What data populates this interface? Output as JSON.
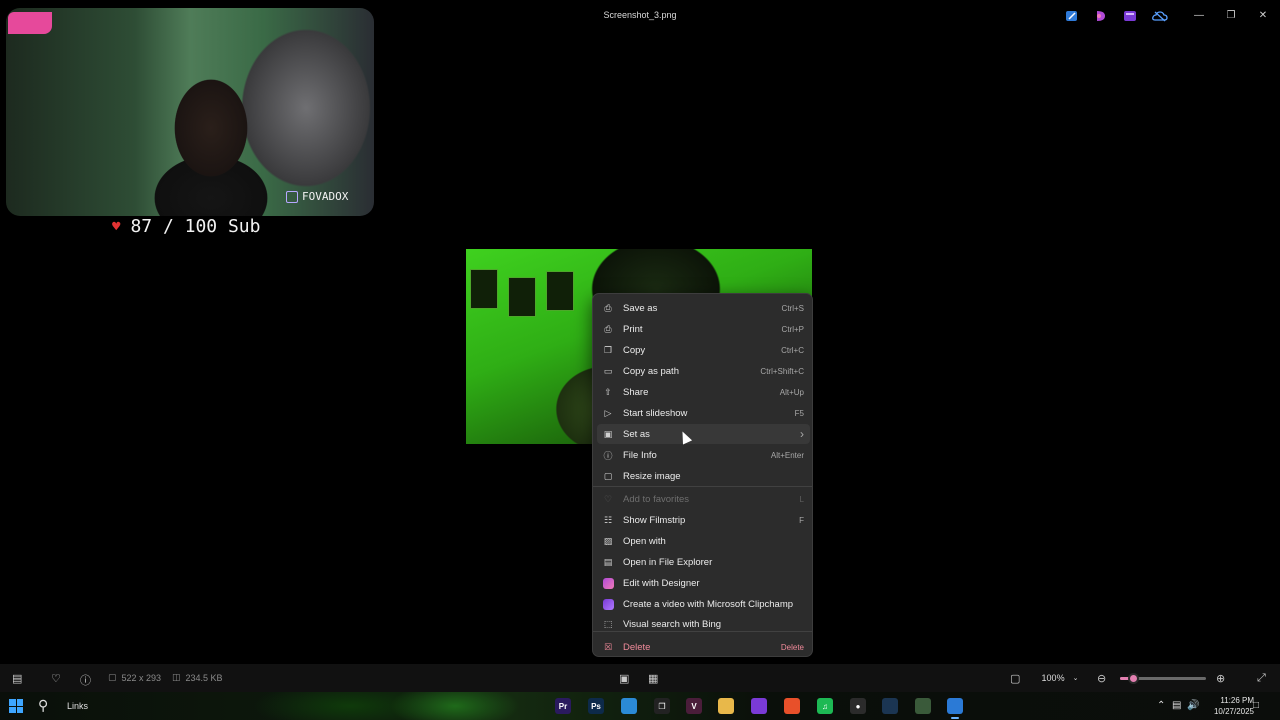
{
  "window": {
    "title": "Screenshot_3.png",
    "minimize_glyph": "—",
    "restore_glyph": "❐",
    "close_glyph": "✕"
  },
  "toolbar_icons": [
    "edit-icon",
    "designer-icon",
    "clipchamp-icon",
    "onedrive-icon"
  ],
  "overlay": {
    "channel_name": "FOVADOX",
    "sub_goal": "87 / 100 Sub"
  },
  "context_menu": {
    "items": [
      {
        "label": "Save as",
        "shortcut": "Ctrl+S",
        "icon": "save-icon"
      },
      {
        "label": "Print",
        "shortcut": "Ctrl+P",
        "icon": "print-icon"
      },
      {
        "label": "Copy",
        "shortcut": "Ctrl+C",
        "icon": "copy-icon"
      },
      {
        "label": "Copy as path",
        "shortcut": "Ctrl+Shift+C",
        "icon": "copy-path-icon"
      },
      {
        "label": "Share",
        "shortcut": "Alt+Up",
        "icon": "share-icon"
      },
      {
        "label": "Start slideshow",
        "shortcut": "F5",
        "icon": "slideshow-icon"
      },
      {
        "label": "Set as",
        "shortcut": "",
        "icon": "set-as-icon",
        "submenu": "›"
      },
      {
        "label": "File Info",
        "shortcut": "Alt+Enter",
        "icon": "info-icon"
      },
      {
        "label": "Resize image",
        "shortcut": "",
        "icon": "resize-icon"
      },
      {
        "label": "Add to favorites",
        "shortcut": "L",
        "icon": "heart-icon"
      },
      {
        "label": "Show Filmstrip",
        "shortcut": "F",
        "icon": "filmstrip-icon"
      },
      {
        "label": "Open with",
        "shortcut": "",
        "icon": "open-with-icon"
      },
      {
        "label": "Open in File Explorer",
        "shortcut": "",
        "icon": "folder-icon"
      },
      {
        "label": "Edit with Designer",
        "shortcut": "",
        "icon": "designer-icon"
      },
      {
        "label": "Create a video with Microsoft Clipchamp",
        "shortcut": "",
        "icon": "clipchamp-icon"
      },
      {
        "label": "Visual search with Bing",
        "shortcut": "",
        "icon": "visual-search-icon"
      },
      {
        "label": "Delete",
        "shortcut": "Delete",
        "icon": "trash-icon"
      }
    ]
  },
  "statusbar": {
    "dimensions": "522 x 293",
    "file_size": "234.5 KB",
    "zoom": "100%",
    "zoom_level_fraction": 0.15
  },
  "taskbar": {
    "search_label": "Links",
    "clock_time": "11:26 PM",
    "clock_date": "10/27/2025",
    "apps": [
      {
        "name": "premiere-pro-app",
        "glyph": "Pr",
        "color": "#2a1a5e"
      },
      {
        "name": "photoshop-app",
        "glyph": "Ps",
        "color": "#0d2a4a"
      },
      {
        "name": "app-icon",
        "glyph": "",
        "color": "#2b8ad6"
      },
      {
        "name": "capcut-app",
        "glyph": "❐",
        "color": "#222222"
      },
      {
        "name": "vscode-like-app",
        "glyph": "V",
        "color": "#4a1d3a"
      },
      {
        "name": "file-explorer-app",
        "glyph": "",
        "color": "#e8b84a"
      },
      {
        "name": "purple-app",
        "glyph": "",
        "color": "#7a3ad6"
      },
      {
        "name": "brave-browser-app",
        "glyph": "",
        "color": "#e8502a"
      },
      {
        "name": "spotify-app",
        "glyph": "♫",
        "color": "#1db954"
      },
      {
        "name": "obs-app",
        "glyph": "●",
        "color": "#2b2b2b"
      },
      {
        "name": "steam-app",
        "glyph": "",
        "color": "#1b3552"
      },
      {
        "name": "app-icon-2",
        "glyph": "",
        "color": "#3a5a3a"
      },
      {
        "name": "photos-app",
        "glyph": "",
        "color": "#2b7ad6"
      }
    ]
  }
}
